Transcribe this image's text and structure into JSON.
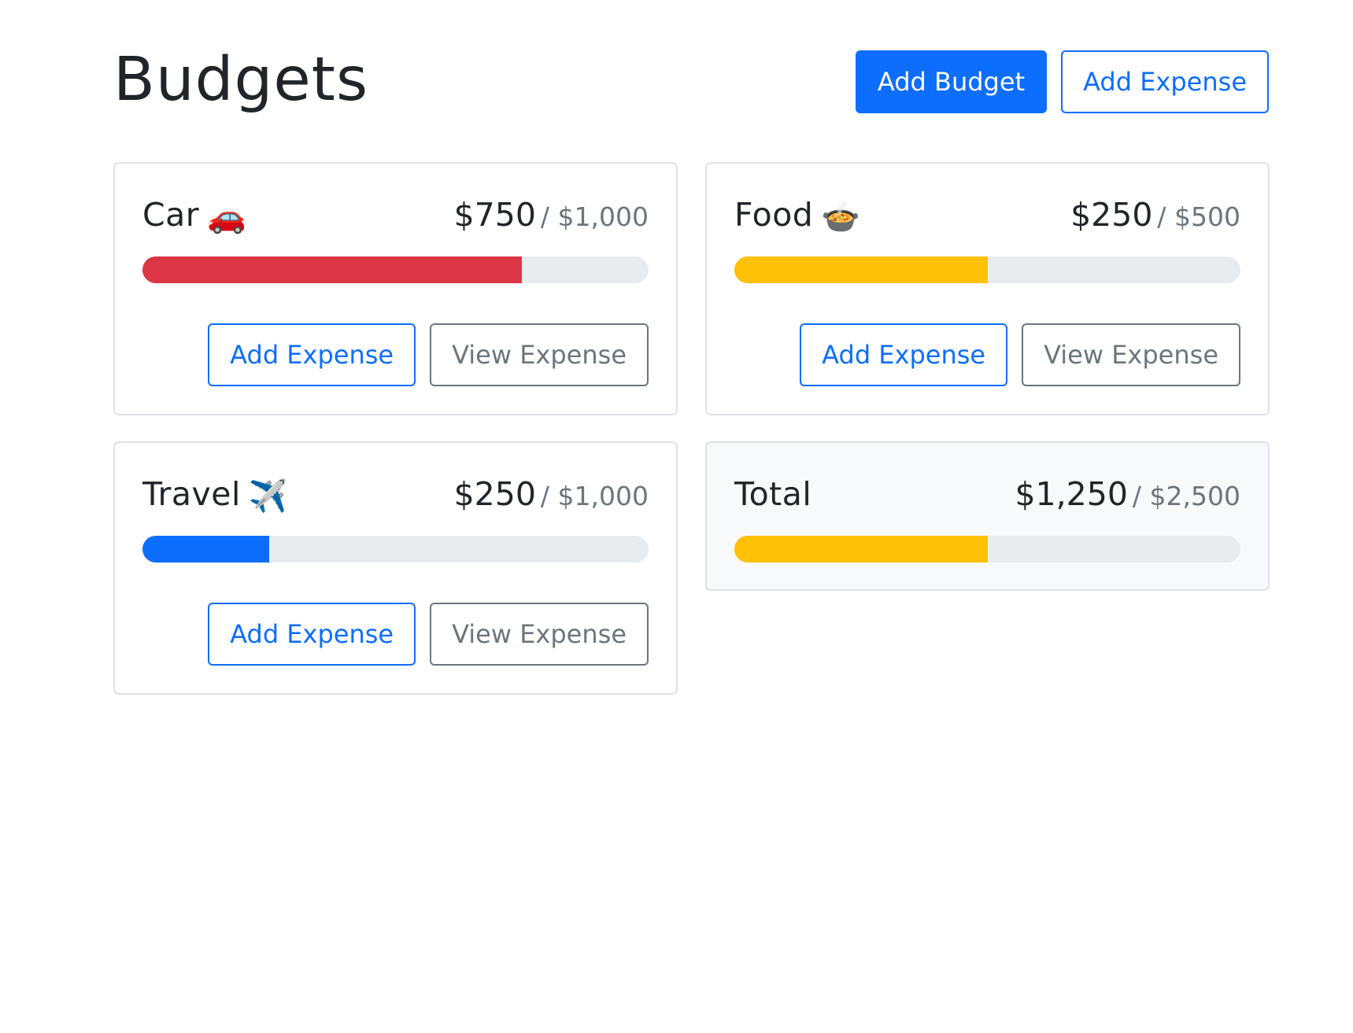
{
  "header": {
    "title": "Budgets",
    "add_budget_label": "Add Budget",
    "add_expense_label": "Add Expense"
  },
  "colors": {
    "primary": "#0d6efd",
    "danger": "#dc3545",
    "warning": "#ffc107",
    "secondary": "#6c757d",
    "track": "#e9ecef"
  },
  "budgets": [
    {
      "name": "Car",
      "icon": "car-icon",
      "emoji": "🚗",
      "spent": "$750",
      "max": "/ $1,000",
      "progress": 0.75,
      "bar_color": "#dc3545",
      "add_label": "Add Expense",
      "view_label": "View Expense"
    },
    {
      "name": "Food",
      "icon": "pot-of-food-icon",
      "emoji": "🍲",
      "spent": "$250",
      "max": "/ $500",
      "progress": 0.5,
      "bar_color": "#ffc107",
      "add_label": "Add Expense",
      "view_label": "View Expense"
    },
    {
      "name": "Travel",
      "icon": "airplane-icon",
      "emoji": "✈️",
      "spent": "$250",
      "max": "/ $1,000",
      "progress": 0.25,
      "bar_color": "#0d6efd",
      "add_label": "Add Expense",
      "view_label": "View Expense"
    }
  ],
  "total": {
    "name": "Total",
    "spent": "$1,250",
    "max": "/ $2,500",
    "progress": 0.5,
    "bar_color": "#ffc107"
  }
}
